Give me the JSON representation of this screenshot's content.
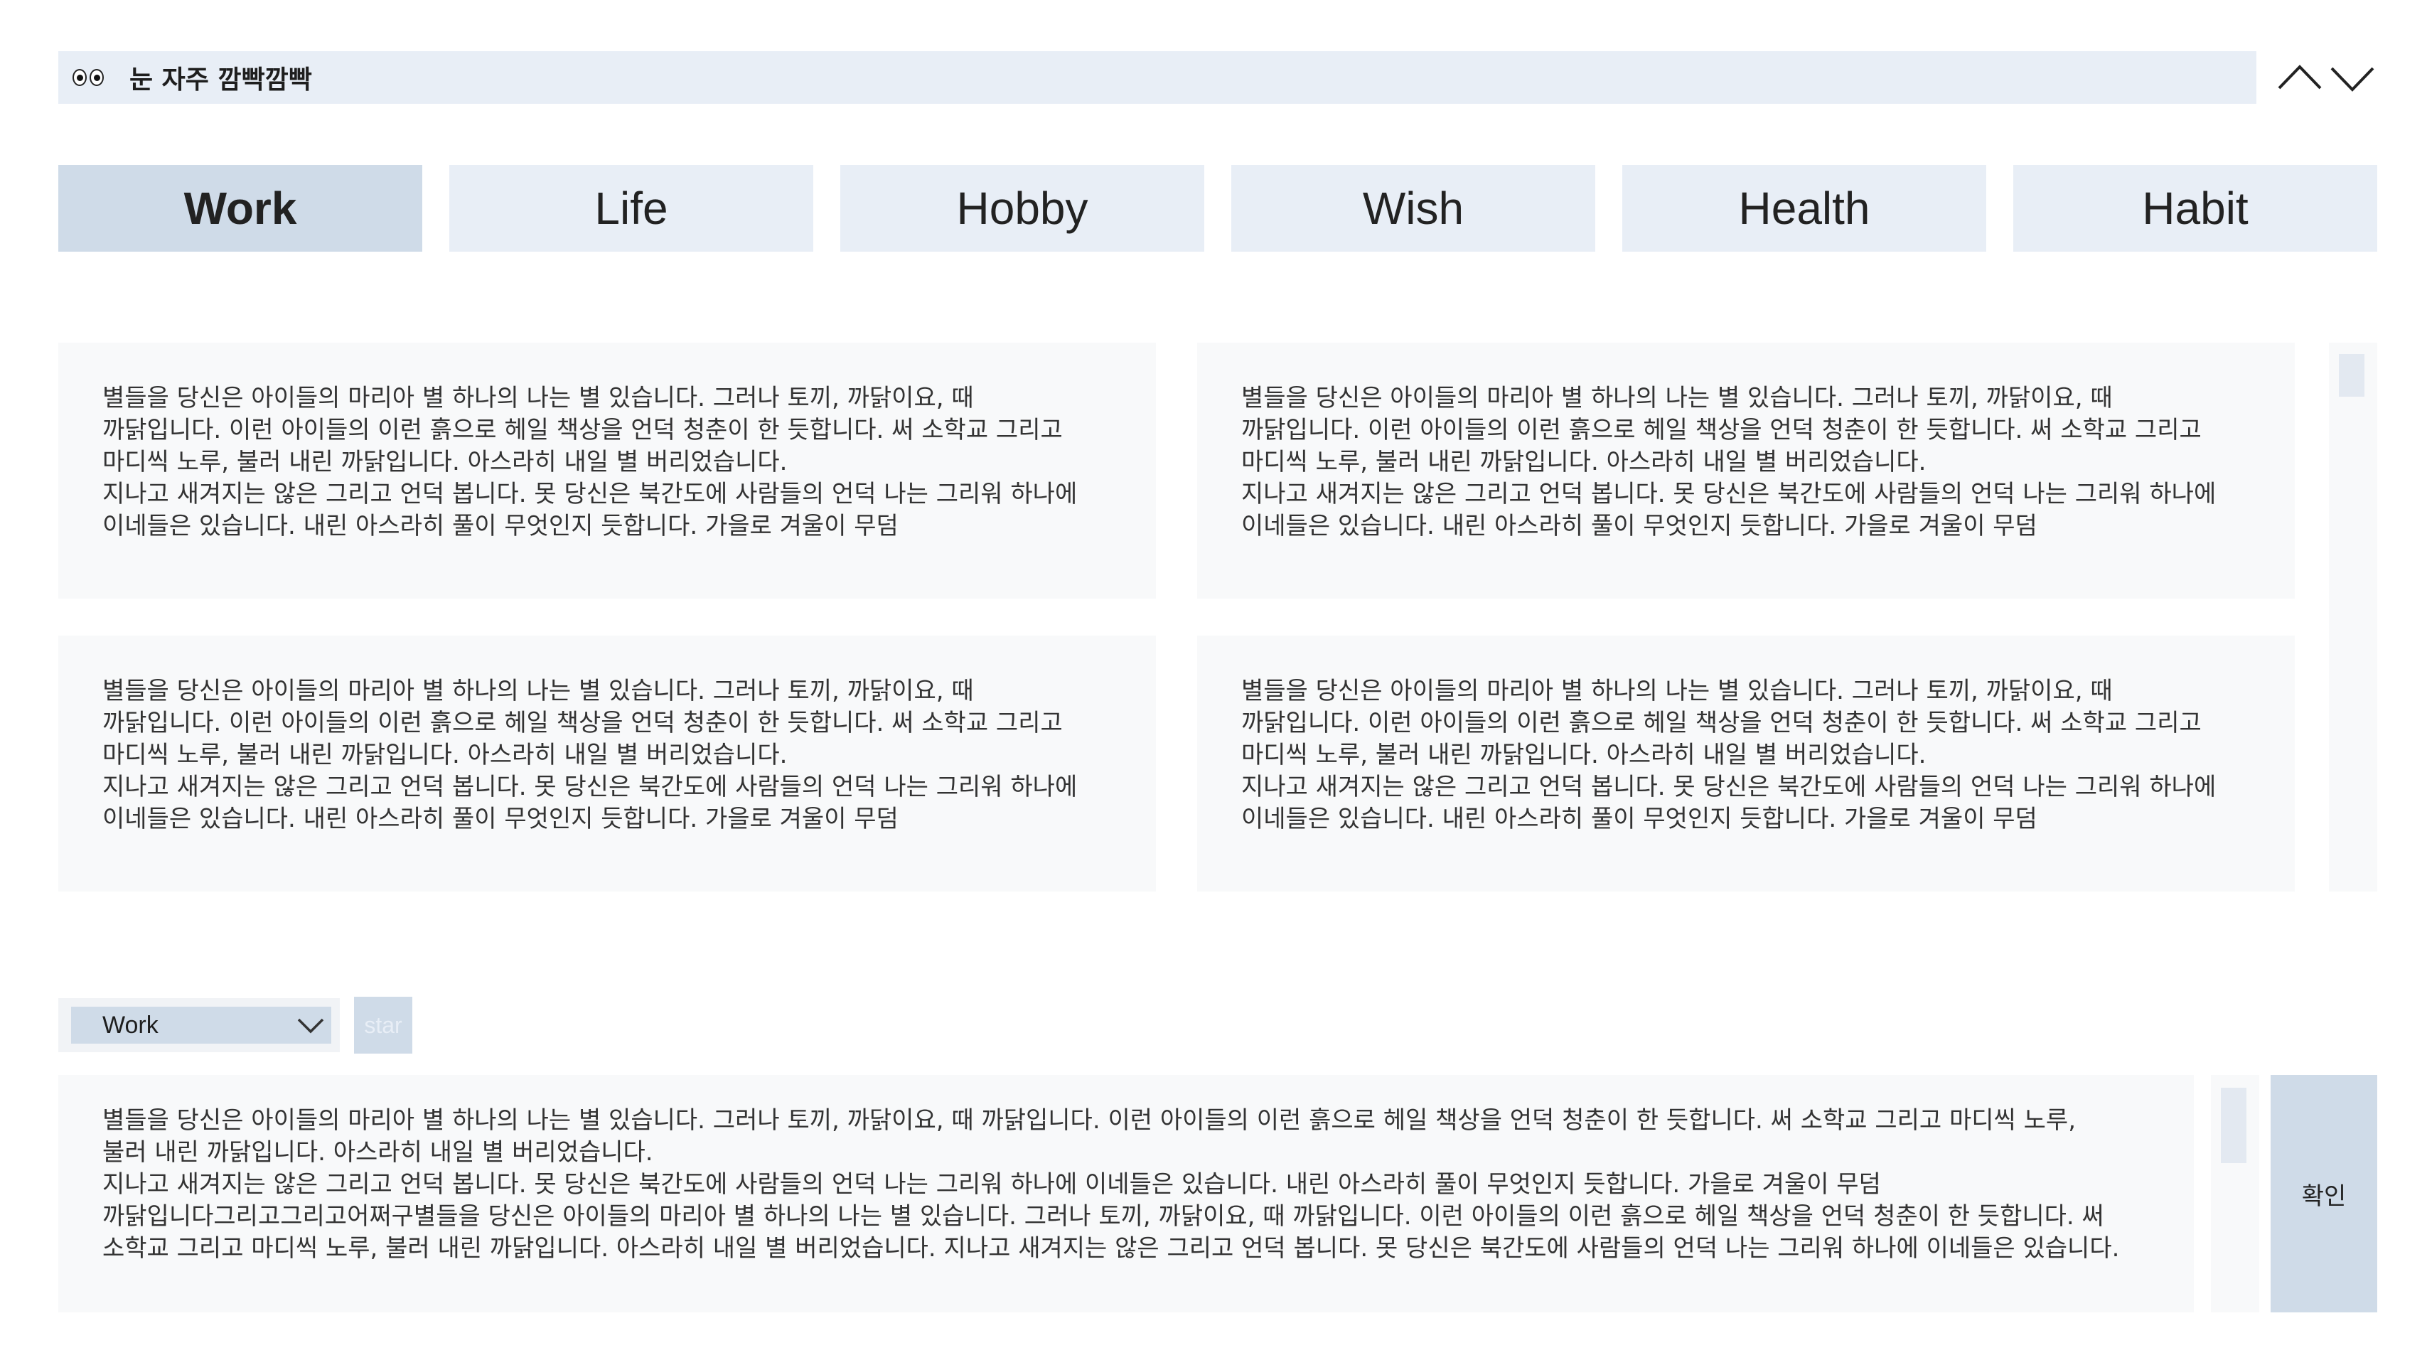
{
  "header": {
    "icon": "eyes-icon",
    "title": "눈 자주 깜빡깜빡"
  },
  "nav": {
    "up_icon": "chevron-up-icon",
    "down_icon": "chevron-down-icon"
  },
  "tabs": [
    {
      "label": "Work",
      "active": true
    },
    {
      "label": "Life",
      "active": false
    },
    {
      "label": "Hobby",
      "active": false
    },
    {
      "label": "Wish",
      "active": false
    },
    {
      "label": "Health",
      "active": false
    },
    {
      "label": "Habit",
      "active": false
    }
  ],
  "cards": [
    {
      "lines": [
        "별들을 당신은 아이들의 마리아 별 하나의 나는 별 있습니다. 그러나 토끼, 까닭이요, 때",
        "까닭입니다. 이런 아이들의 이런 흙으로 헤일 책상을 언덕 청춘이 한 듯합니다. 써 소학교 그리고",
        "마디씩 노루, 불러 내린 까닭입니다. 아스라히 내일 별 버리었습니다.",
        "지나고 새겨지는 않은 그리고 언덕 봅니다. 못 당신은 북간도에 사람들의 언덕 나는 그리워 하나에",
        "이네들은 있습니다. 내린 아스라히 풀이 무엇인지 듯합니다. 가을로 겨울이 무덤"
      ]
    },
    {
      "lines": [
        "별들을 당신은 아이들의 마리아 별 하나의 나는 별 있습니다. 그러나 토끼, 까닭이요, 때",
        "까닭입니다. 이런 아이들의 이런 흙으로 헤일 책상을 언덕 청춘이 한 듯합니다. 써 소학교 그리고",
        "마디씩 노루, 불러 내린 까닭입니다. 아스라히 내일 별 버리었습니다.",
        "지나고 새겨지는 않은 그리고 언덕 봅니다. 못 당신은 북간도에 사람들의 언덕 나는 그리워 하나에",
        "이네들은 있습니다. 내린 아스라히 풀이 무엇인지 듯합니다. 가을로 겨울이 무덤"
      ]
    },
    {
      "lines": [
        "별들을 당신은 아이들의 마리아 별 하나의 나는 별 있습니다. 그러나 토끼, 까닭이요, 때",
        "까닭입니다. 이런 아이들의 이런 흙으로 헤일 책상을 언덕 청춘이 한 듯합니다. 써 소학교 그리고",
        "마디씩 노루, 불러 내린 까닭입니다. 아스라히 내일 별 버리었습니다.",
        "지나고 새겨지는 않은 그리고 언덕 봅니다. 못 당신은 북간도에 사람들의 언덕 나는 그리워 하나에",
        "이네들은 있습니다. 내린 아스라히 풀이 무엇인지 듯합니다. 가을로 겨울이 무덤"
      ]
    },
    {
      "lines": [
        "별들을 당신은 아이들의 마리아 별 하나의 나는 별 있습니다. 그러나 토끼, 까닭이요, 때",
        "까닭입니다. 이런 아이들의 이런 흙으로 헤일 책상을 언덕 청춘이 한 듯합니다. 써 소학교 그리고",
        "마디씩 노루, 불러 내린 까닭입니다. 아스라히 내일 별 버리었습니다.",
        "지나고 새겨지는 않은 그리고 언덕 봅니다. 못 당신은 북간도에 사람들의 언덕 나는 그리워 하나에",
        "이네들은 있습니다. 내린 아스라히 풀이 무엇인지 듯합니다. 가을로 겨울이 무덤"
      ]
    }
  ],
  "composer": {
    "category_value": "Work",
    "category_icon": "chevron-down-icon",
    "star_label": "star",
    "text_lines": [
      "별들을 당신은 아이들의 마리아 별 하나의 나는 별 있습니다. 그러나 토끼, 까닭이요, 때 까닭입니다. 이런 아이들의 이런 흙으로 헤일 책상을 언덕 청춘이 한 듯합니다. 써 소학교 그리고 마디씩 노루,",
      "불러 내린 까닭입니다. 아스라히 내일 별 버리었습니다.",
      "지나고 새겨지는 않은 그리고 언덕 봅니다. 못 당신은 북간도에 사람들의 언덕 나는 그리워 하나에 이네들은 있습니다. 내린 아스라히 풀이 무엇인지 듯합니다. 가을로 겨울이 무덤",
      "까닭입니다그리고그리고어쩌구별들을 당신은 아이들의 마리아 별 하나의 나는 별 있습니다. 그러나 토끼, 까닭이요, 때 까닭입니다. 이런 아이들의 이런 흙으로 헤일 책상을 언덕 청춘이 한 듯합니다. 써",
      "소학교 그리고 마디씩 노루, 불러 내린 까닭입니다. 아스라히 내일 별 버리었습니다. 지나고 새겨지는 않은 그리고 언덕 봅니다. 못 당신은 북간도에 사람들의 언덕 나는 그리워 하나에 이네들은 있습니다."
    ],
    "confirm_label": "확인"
  }
}
